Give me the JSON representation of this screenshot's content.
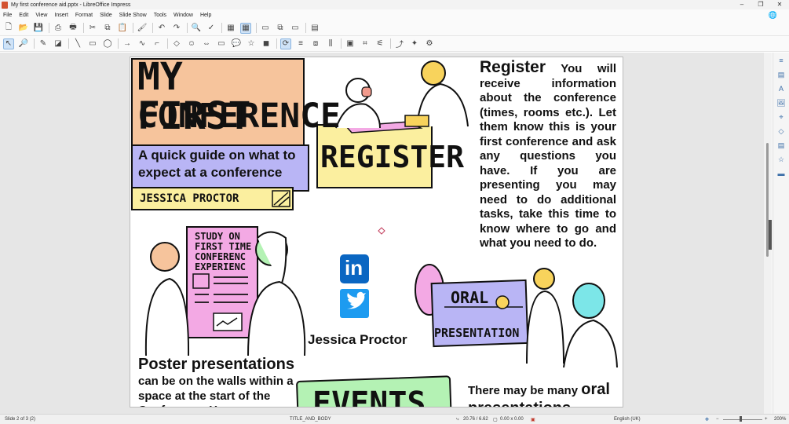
{
  "window": {
    "title": "My first conference aid.pptx - LibreOffice Impress",
    "min": "–",
    "max": "❐",
    "close": "✕"
  },
  "menu": [
    "File",
    "Edit",
    "View",
    "Insert",
    "Format",
    "Slide",
    "Slide Show",
    "Tools",
    "Window",
    "Help"
  ],
  "slide": {
    "conf_title_1": "MY FIRST",
    "conf_title_2": "CONFERENCE",
    "guide": "A quick guide on what to expect at a conference",
    "author_banner": "JESSICA PROCTOR",
    "register_word": "REGISTER",
    "register_heading": "Register",
    "register_body": "You will receive information about the conference (times, rooms etc.). Let them know this is your first conference and ask any questions you have. If you are presenting you may need to do additional tasks, take this time to know where to go and what you need to do.",
    "poster_sign": [
      "STUDY ON",
      "FIRST TIME",
      "CONFERENC",
      "EXPERIENC"
    ],
    "linkedin": "in",
    "author_name": "Jessica Proctor",
    "oral_sign_1": "ORAL",
    "oral_sign_2": "PRESENTATION",
    "poster_heading": "Poster presentations",
    "poster_body": "can be on the walls within a space at the start of the Conference. You can",
    "oral_prefix": "There may be many",
    "oral_word": "oral",
    "oral_rest": "presentations",
    "events_sign": "EVENTS"
  },
  "status": {
    "slide": "Slide 2 of 3 (2)",
    "layout": "TITLE_AND_BODY",
    "position": "20.76 / 6.62",
    "size": "0.00 x 0.00",
    "language": "English (UK)",
    "zoom": "200%"
  },
  "colors": {
    "peach": "#f6c49c",
    "lavender": "#b9b5f5",
    "yellow": "#fbef9f",
    "pink": "#f3a9e4",
    "linkedin": "#0a66c2",
    "twitter": "#1d9bf0"
  }
}
